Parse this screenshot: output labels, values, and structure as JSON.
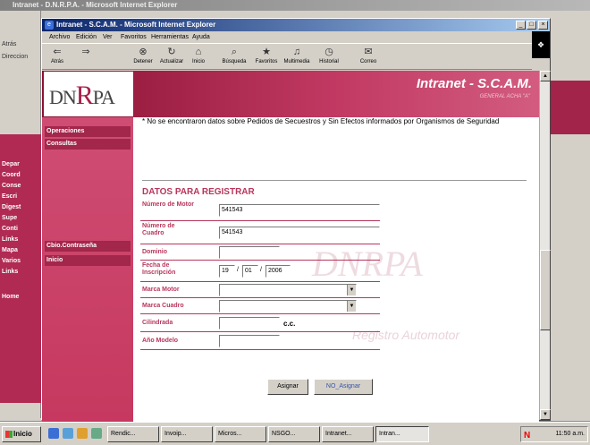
{
  "back_window": {
    "title": "Intranet - D.N.R.P.A. - Microsoft Internet Explorer",
    "toolbar": [
      "Atrás",
      "Direccion"
    ],
    "sidebar": [
      "Depar",
      "Coord",
      "Conse",
      "Escri",
      "Digest",
      "Supe",
      "Conti",
      "Links",
      "Mapa",
      "Varios",
      "Links",
      "Home"
    ]
  },
  "window": {
    "title": "Intranet - S.C.A.M. - Microsoft Internet Explorer",
    "controls": [
      "_",
      "□",
      "×"
    ]
  },
  "menu": [
    "Archivo",
    "Edición",
    "Ver",
    "Favoritos",
    "Herramientas",
    "Ayuda"
  ],
  "toolbar": [
    {
      "label": "Atrás",
      "icon": "back-arrow-icon",
      "glyph": "⇐"
    },
    {
      "label": "",
      "icon": "forward-arrow-icon",
      "glyph": "⇒"
    },
    {
      "label": "Detener",
      "icon": "stop-icon",
      "glyph": "⊗"
    },
    {
      "label": "Actualizar",
      "icon": "refresh-icon",
      "glyph": "↻"
    },
    {
      "label": "Inicio",
      "icon": "home-icon",
      "glyph": "⌂"
    },
    {
      "label": "Búsqueda",
      "icon": "search-icon",
      "glyph": "⌕"
    },
    {
      "label": "Favoritos",
      "icon": "favorites-icon",
      "glyph": "★"
    },
    {
      "label": "Multimedia",
      "icon": "media-icon",
      "glyph": "♫"
    },
    {
      "label": "Historial",
      "icon": "history-icon",
      "glyph": "◷"
    },
    {
      "label": "Correo",
      "icon": "mail-icon",
      "glyph": "✉"
    }
  ],
  "header": {
    "logo_left": "DN",
    "logo_r": "R",
    "logo_right": "PA",
    "title": "Intranet - S.C.A.M.",
    "subtitle": "GENERAL ACHA \"A\""
  },
  "sidebar": {
    "items": [
      "Operaciones",
      "Consultas",
      "Cbio.Contraseña",
      "Inicio"
    ]
  },
  "notice": "* No se encontraron datos sobre Pedidos de Secuestros y Sin Efectos informados por Organismos de Seguridad",
  "form": {
    "section_title": "DATOS PARA REGISTRAR",
    "numero_motor_label": "Número de Motor",
    "numero_motor_value": "541543",
    "numero_cuadro_label": "Número de Cuadro",
    "numero_cuadro_value": "541543",
    "dominio_label": "Dominio",
    "dominio_value": "",
    "fecha_label": "Fecha de Inscripción",
    "fecha_dia": "19",
    "fecha_mes": "01",
    "fecha_anio": "2006",
    "fecha_sep": "/",
    "marca_motor_label": "Marca Motor",
    "marca_motor_value": "",
    "marca_cuadro_label": "Marca Cuadro",
    "marca_cuadro_value": "",
    "cilindrada_label": "Cilindrada",
    "cilindrada_value": "",
    "cilindrada_unit": "c.c.",
    "anio_modelo_label": "Año Modelo",
    "anio_modelo_value": ""
  },
  "buttons": {
    "asignar": "Asignar",
    "no_asignar": "NO_Asignar"
  },
  "watermark": {
    "main": "DNRPA",
    "sub": "Registro Automotor"
  },
  "taskbar": {
    "start": "Inicio",
    "tasks": [
      "Rendic...",
      "Invoip...",
      "Micros...",
      "NSGO...",
      "Intranet...",
      "Intran..."
    ],
    "tray_time": "11:50 a.m.",
    "tray_letter": "N"
  },
  "colors": {
    "brand": "#b8365c",
    "header_dark": "#8a1233",
    "titlebar": "#0a246a"
  }
}
